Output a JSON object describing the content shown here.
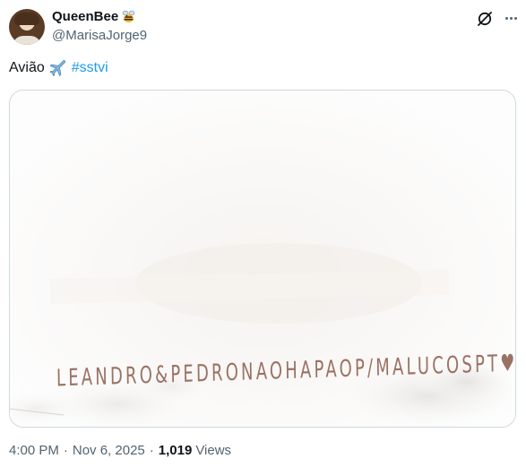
{
  "author": {
    "display_name": "QueenBee",
    "badge_icon": "bee-icon",
    "handle": "@MarisaJorge9"
  },
  "header_actions": {
    "grok_icon": "grok-icon",
    "more_icon": "more-icon"
  },
  "tweet": {
    "text": "Avião",
    "emoji_icon": "airplane-icon",
    "hashtag": "#sstvi"
  },
  "media": {
    "banner_text": "LEANDRO&PEDRONAOHAPAOP/MALUCOSPT♥SAVATE"
  },
  "meta": {
    "time": "4:00 PM",
    "date": "Nov 6, 2025",
    "views_count": "1,019",
    "views_label": "Views"
  },
  "colors": {
    "text_primary": "#0f1419",
    "text_secondary": "#536471",
    "link": "#1d9bf0",
    "border": "#cfd9de"
  }
}
